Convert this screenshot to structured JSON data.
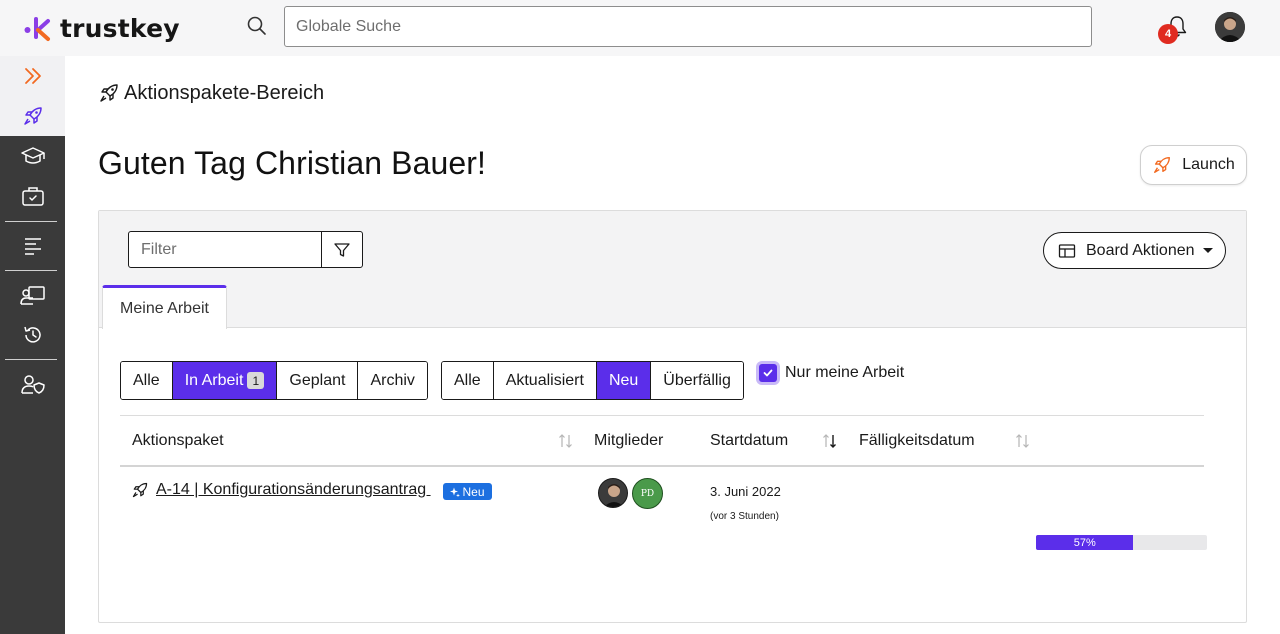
{
  "app": {
    "brand": "trustkey",
    "accent_color": "#5b2eea",
    "logo_colors": [
      "#f26a21",
      "#8b3ee6"
    ]
  },
  "header": {
    "search_placeholder": "Globale Suche",
    "notifications_count": "4"
  },
  "sidebar": {
    "icons": [
      "chevrons-right-icon",
      "rocket-icon",
      "graduation-cap-icon",
      "briefcase-icon",
      "list-icon",
      "presentation-icon",
      "history-icon",
      "user-shield-icon"
    ]
  },
  "breadcrumb": {
    "label": "Aktionspakete-Bereich"
  },
  "page": {
    "greeting": "Guten Tag Christian Bauer!",
    "launch_label": "Launch"
  },
  "board": {
    "filter_placeholder": "Filter",
    "actions_label": "Board Aktionen",
    "tab_label": "Meine Arbeit",
    "status_filters": [
      {
        "label": "Alle",
        "selected": false
      },
      {
        "label": "In Arbeit",
        "selected": true,
        "count": "1"
      },
      {
        "label": "Geplant",
        "selected": false
      },
      {
        "label": "Archiv",
        "selected": false
      }
    ],
    "update_filters": [
      {
        "label": "Alle",
        "selected": false
      },
      {
        "label": "Aktualisiert",
        "selected": false
      },
      {
        "label": "Neu",
        "selected": true
      },
      {
        "label": "Überfällig",
        "selected": false
      }
    ],
    "only_mine": {
      "label": "Nur meine Arbeit",
      "checked": true
    }
  },
  "table": {
    "columns": [
      "Aktionspaket",
      "Mitglieder",
      "Startdatum",
      "Fälligkeitsdatum"
    ],
    "rows": [
      {
        "name": "A-14 | Konfigurationsänderungsantrag ",
        "badge": "Neu",
        "members": [
          "photo",
          "PD"
        ],
        "start_date": "3. Juni 2022",
        "start_relative": "(vor 3 Stunden)",
        "progress_label": "57%",
        "progress_fraction": 0.57
      }
    ]
  }
}
